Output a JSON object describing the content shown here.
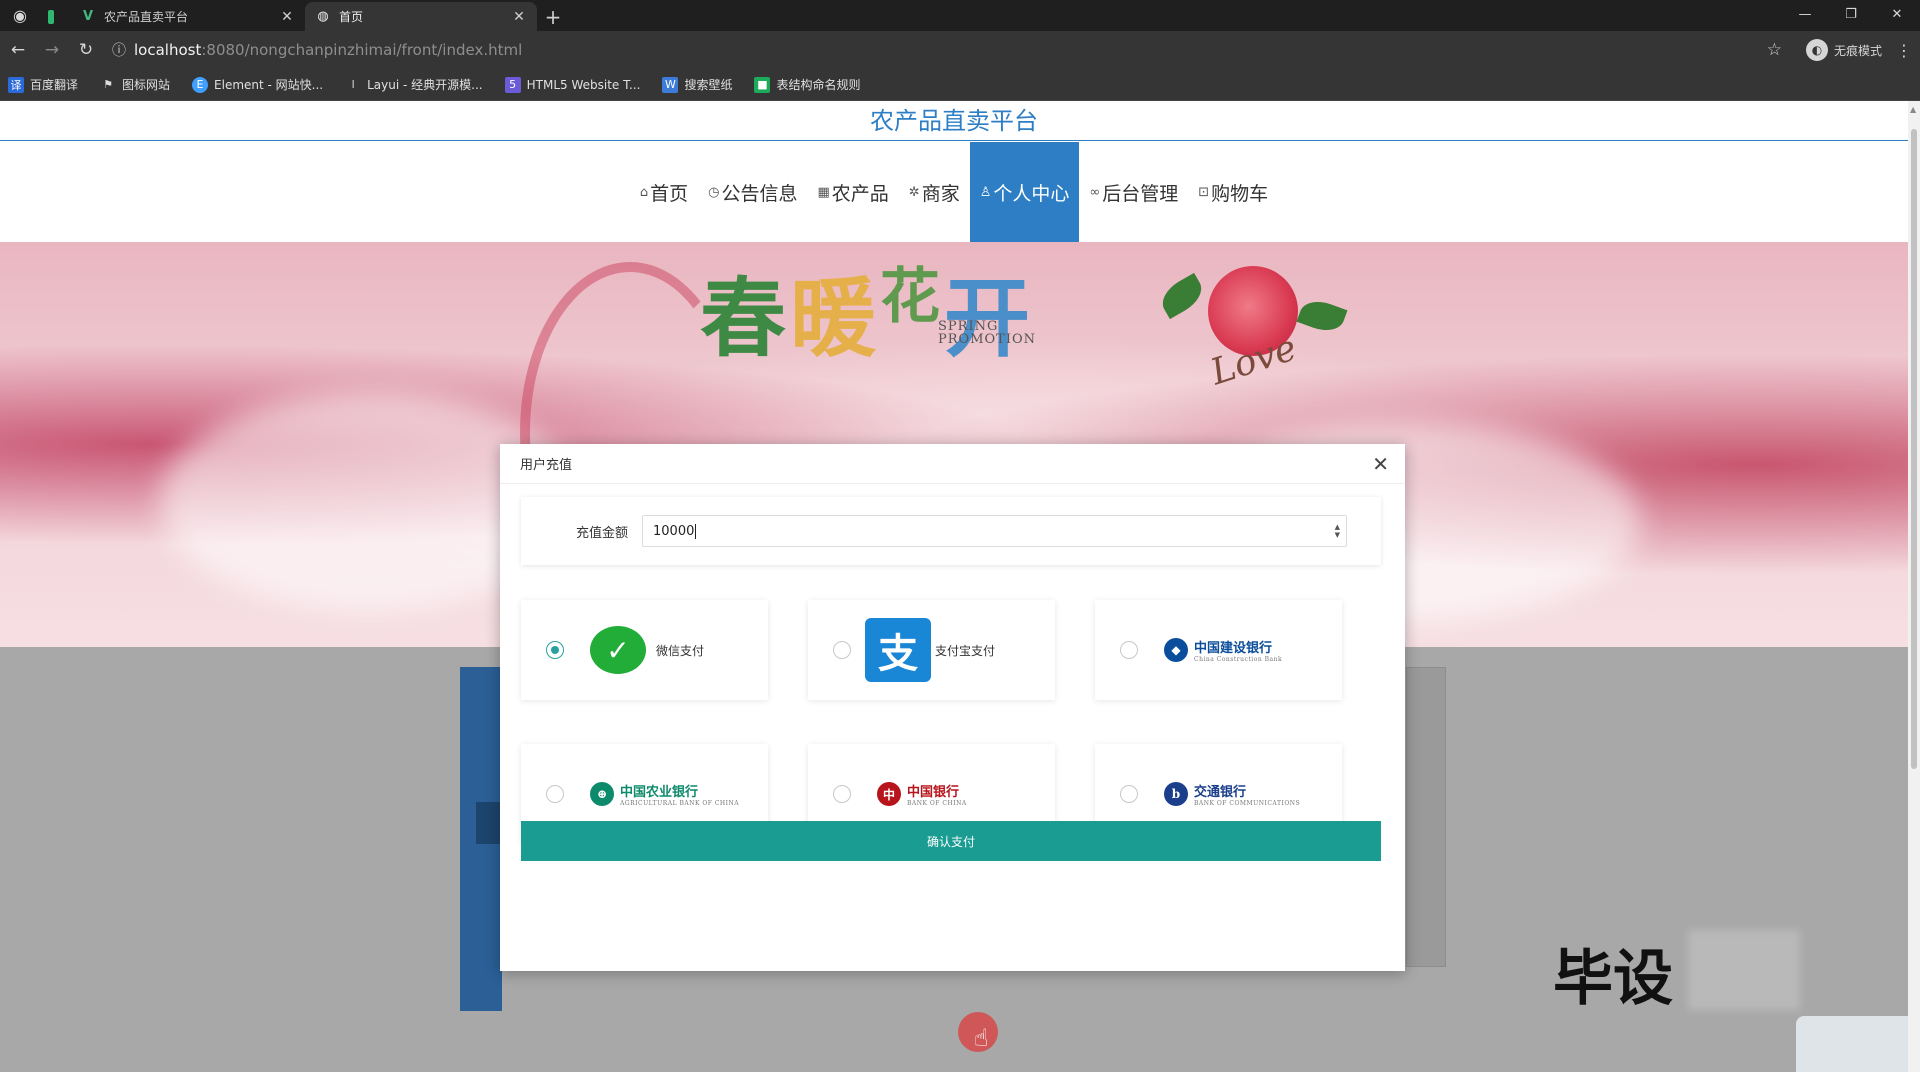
{
  "browser": {
    "tabs": [
      {
        "title": ""
      },
      {
        "title": "农产品直卖平台"
      },
      {
        "title": "首页"
      }
    ],
    "url_host": "localhost",
    "url_path": ":8080/nongchanpinzhimai/front/index.html",
    "incognito_label": "无痕模式",
    "bookmarks": [
      "百度翻译",
      "图标网站",
      "Element - 网站快...",
      "Layui - 经典开源模...",
      "HTML5 Website T...",
      "搜索壁纸",
      "表结构命名规则"
    ]
  },
  "site": {
    "title": "农产品直卖平台",
    "nav": [
      {
        "label": "首页",
        "icon": "home-icon",
        "active": false
      },
      {
        "label": "公告信息",
        "icon": "clock-icon",
        "active": false
      },
      {
        "label": "农产品",
        "icon": "grid-icon",
        "active": false
      },
      {
        "label": "商家",
        "icon": "gear-icon",
        "active": false
      },
      {
        "label": "个人中心",
        "icon": "user-icon",
        "active": true
      },
      {
        "label": "后台管理",
        "icon": "link-icon",
        "active": false
      },
      {
        "label": "购物车",
        "icon": "cart-icon",
        "active": false
      }
    ]
  },
  "banner": {
    "headline_chars": [
      "春",
      "暖",
      "花",
      "开"
    ],
    "subtitle_line1": "SPRING",
    "subtitle_line2": "PROMOTION",
    "love_text": "Love"
  },
  "modal": {
    "title": "用户充值",
    "amount_label": "充值金额",
    "amount_value": "10000",
    "payment_methods": [
      {
        "name": "微信支付",
        "checked": true,
        "logo": "wechat-logo"
      },
      {
        "name": "支付宝支付",
        "checked": false,
        "logo": "alipay-logo"
      },
      {
        "name": "中国建设银行",
        "sub": "China Construction Bank",
        "checked": false,
        "logo": "ccb-logo",
        "color": "#0a4d9c"
      },
      {
        "name": "中国农业银行",
        "sub": "AGRICULTURAL BANK OF CHINA",
        "checked": false,
        "logo": "abc-logo",
        "color": "#0d8a6c"
      },
      {
        "name": "中国银行",
        "sub": "BANK OF CHINA",
        "checked": false,
        "logo": "boc-logo",
        "color": "#b8141c"
      },
      {
        "name": "交通银行",
        "sub": "BANK OF COMMUNICATIONS",
        "checked": false,
        "logo": "bocom-logo",
        "color": "#1b3f8b"
      }
    ],
    "confirm_label": "确认支付"
  },
  "overlay": {
    "watermark_text": "毕设"
  },
  "colors": {
    "accent": "#2d7ec4",
    "confirm": "#1a9c92",
    "radio_checked": "#2aa1a1"
  }
}
